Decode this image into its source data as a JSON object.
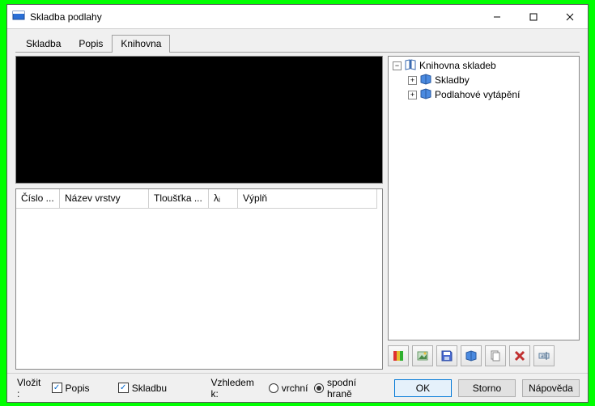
{
  "window": {
    "title": "Skladba podlahy"
  },
  "tabs": [
    {
      "label": "Skladba",
      "active": false
    },
    {
      "label": "Popis",
      "active": false
    },
    {
      "label": "Knihovna",
      "active": true
    }
  ],
  "grid": {
    "columns": [
      {
        "label": "Číslo ...",
        "width": 54
      },
      {
        "label": "Název vrstvy",
        "width": 110
      },
      {
        "label": "Tloušťka ...",
        "width": 74
      },
      {
        "label": "λᵢ",
        "width": 36
      },
      {
        "label": "Výplň",
        "width": 172
      }
    ]
  },
  "tree": {
    "root": {
      "label": "Knihovna skladeb",
      "expanded": true
    },
    "children": [
      {
        "label": "Skladby",
        "expanded": false
      },
      {
        "label": "Podlahové vytápění",
        "expanded": false
      }
    ]
  },
  "toolbar_icons": [
    "layers",
    "image",
    "save",
    "book",
    "copy",
    "delete",
    "rename"
  ],
  "bottom": {
    "insert_label": "Vložit :",
    "popis": {
      "label": "Popis",
      "checked": true
    },
    "skladbu": {
      "label": "Skladbu",
      "checked": true
    },
    "vzhledem_label": "Vzhledem k:",
    "radio_vrchni": {
      "label": "vrchní",
      "selected": false
    },
    "radio_spodni": {
      "label": "spodní hraně",
      "selected": true
    }
  },
  "buttons": {
    "ok": "OK",
    "storno": "Storno",
    "napoveda": "Nápověda"
  }
}
